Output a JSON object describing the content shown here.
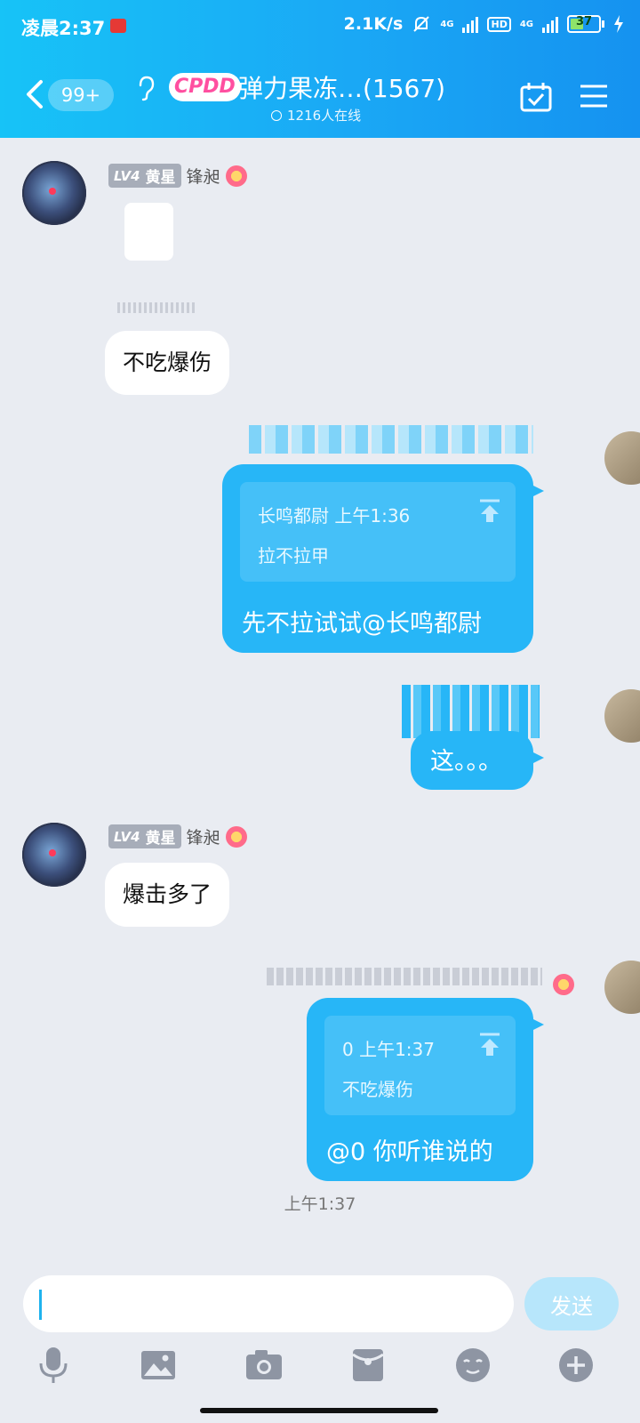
{
  "status_bar": {
    "time": "凌晨2:37",
    "net_speed": "2.1K/s",
    "net1": "4G",
    "hd": "HD",
    "net2": "4G",
    "battery": "37"
  },
  "header": {
    "unread": "99+",
    "group_logo": "CPDD",
    "group_title": "弹力果冻…(1567)",
    "online": "1216人在线"
  },
  "messages": [
    {
      "id": "m1",
      "side": "left",
      "level": "LV4",
      "title": "黄星",
      "sender": "锋昶",
      "text": "不吃爆伤"
    },
    {
      "id": "m2",
      "side": "right",
      "quote_meta": "长鸣都尉 上午1:36",
      "quote_text": "拉不拉甲",
      "text": "先不拉试试@长鸣都尉"
    },
    {
      "id": "m3",
      "side": "right",
      "text": "这。。。"
    },
    {
      "id": "m4",
      "side": "left",
      "level": "LV4",
      "title": "黄星",
      "sender": "锋昶",
      "text": "爆击多了"
    },
    {
      "id": "m5",
      "side": "right",
      "quote_meta": "0 上午1:37",
      "quote_text": "不吃爆伤",
      "text": "@0 你听谁说的"
    }
  ],
  "time_separator": "上午1:37",
  "input": {
    "value": "",
    "send_label": "发送"
  },
  "toolbar": [
    "mic-icon",
    "image-icon",
    "camera-icon",
    "red-packet-icon",
    "emoji-icon",
    "plus-icon"
  ],
  "colors": {
    "header_start": "#17c3f7",
    "header_end": "#1592f0",
    "bubble_self": "#27b6f7",
    "bubble_other": "#ffffff",
    "background": "#e9ecf2"
  }
}
